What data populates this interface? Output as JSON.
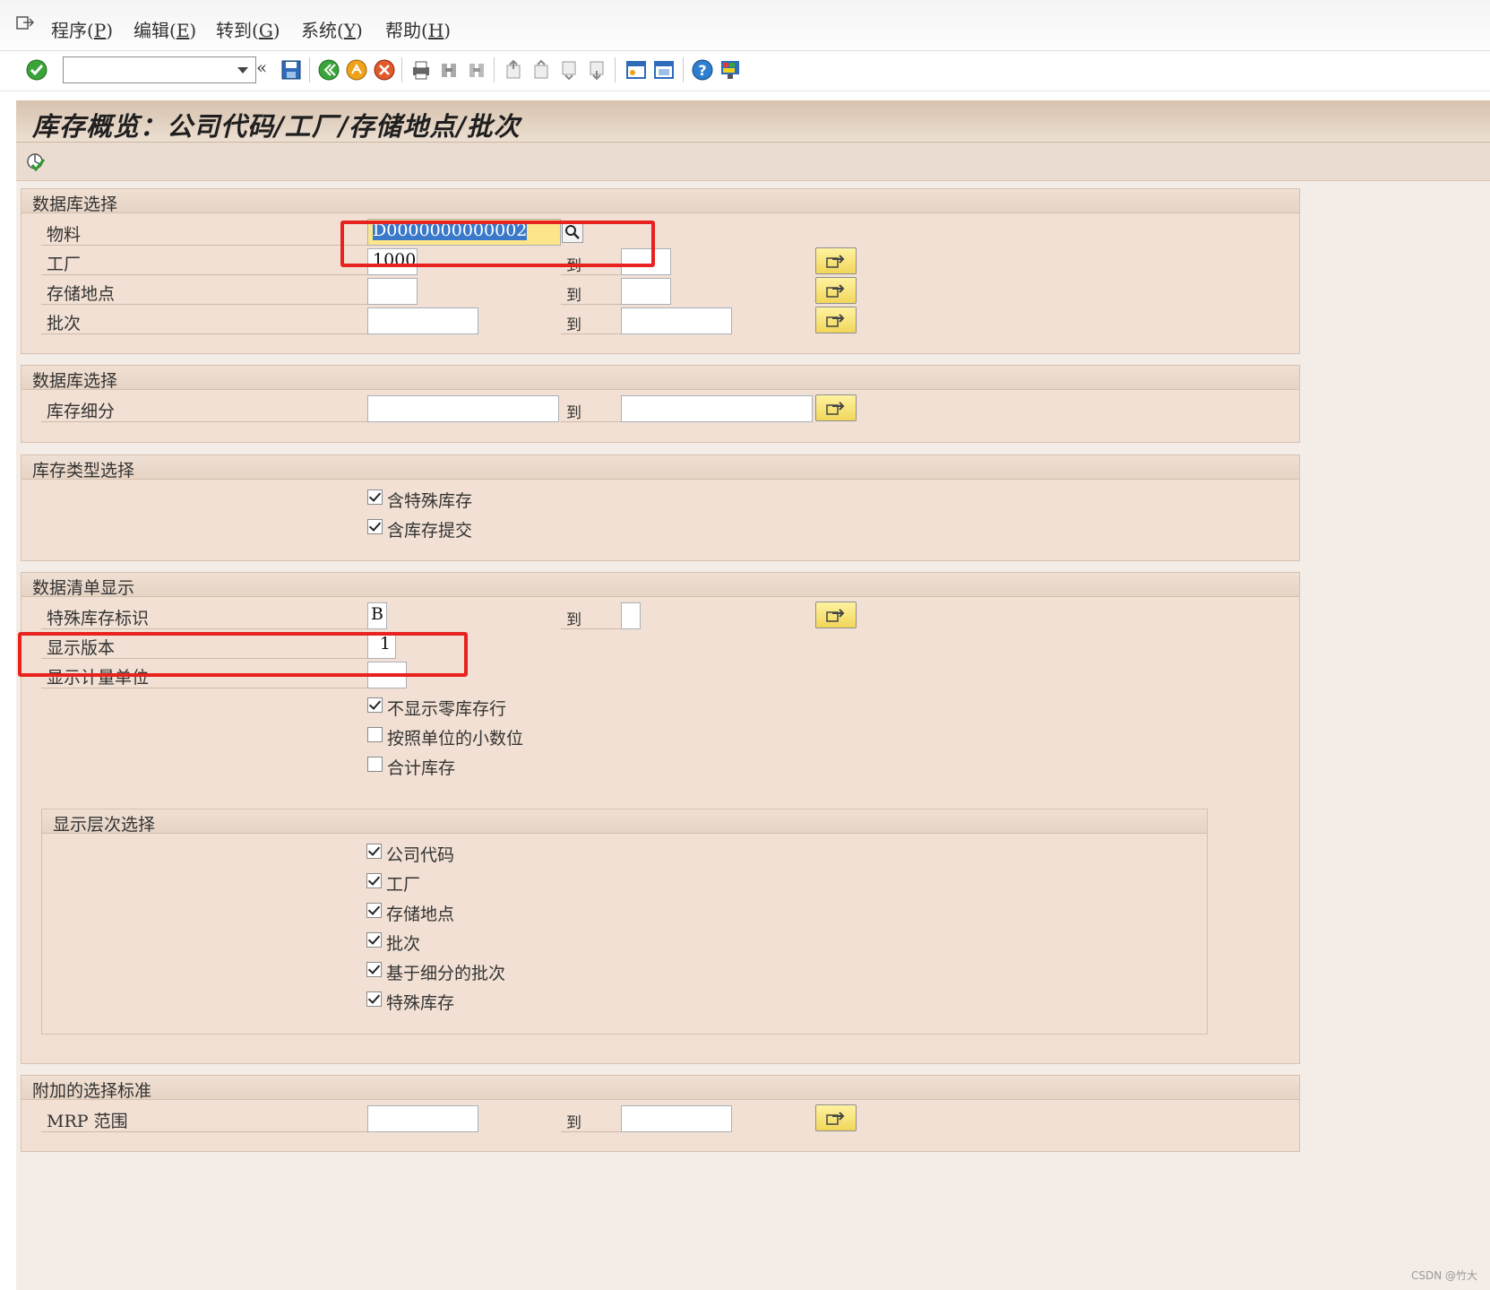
{
  "menu": {
    "items": [
      {
        "label": "程序(",
        "key": "P",
        "end": ")"
      },
      {
        "label": "编辑(",
        "key": "E",
        "end": ")"
      },
      {
        "label": "转到(",
        "key": "G",
        "end": ")"
      },
      {
        "label": "系统(",
        "key": "Y",
        "end": ")"
      },
      {
        "label": "帮助(",
        "key": "H",
        "end": ")"
      }
    ]
  },
  "toolbar": {
    "back_label": "«",
    "command_value": ""
  },
  "page": {
    "title": "库存概览：公司代码/工厂/存储地点/批次"
  },
  "common": {
    "to_label": "到"
  },
  "sections": {
    "db1": {
      "title": "数据库选择",
      "material_label": "物料",
      "material_value": "D0000000000002",
      "plant_label": "工厂",
      "plant_value": "1000",
      "plant_to": "",
      "sloc_label": "存储地点",
      "sloc_value": "",
      "sloc_to": "",
      "batch_label": "批次",
      "batch_value": "",
      "batch_to": ""
    },
    "db2": {
      "title": "数据库选择",
      "breakdown_label": "库存细分",
      "breakdown_value": "",
      "breakdown_to": ""
    },
    "stocktype": {
      "title": "库存类型选择",
      "cb1": {
        "label": "含特殊库存",
        "checked": true
      },
      "cb2": {
        "label": "含库存提交",
        "checked": true
      }
    },
    "list": {
      "title": "数据清单显示",
      "special_label": "特殊库存标识",
      "special_value": "B",
      "special_to": "",
      "version_label": "显示版本",
      "version_value": "1",
      "uom_label": "显示计量单位",
      "uom_value": "",
      "cb1": {
        "label": "不显示零库存行",
        "checked": true
      },
      "cb2": {
        "label": "按照单位的小数位",
        "checked": false
      },
      "cb3": {
        "label": "合计库存",
        "checked": false
      }
    },
    "hier": {
      "title": "显示层次选择",
      "cb1": {
        "label": "公司代码",
        "checked": true
      },
      "cb2": {
        "label": "工厂",
        "checked": true
      },
      "cb3": {
        "label": "存储地点",
        "checked": true
      },
      "cb4": {
        "label": "批次",
        "checked": true
      },
      "cb5": {
        "label": "基于细分的批次",
        "checked": true
      },
      "cb6": {
        "label": "特殊库存",
        "checked": true
      }
    },
    "extra": {
      "title": "附加的选择标准",
      "mrp_label": "MRP 范围",
      "mrp_value": "",
      "mrp_to": ""
    }
  },
  "footer": {
    "watermark": "CSDN @竹大"
  }
}
